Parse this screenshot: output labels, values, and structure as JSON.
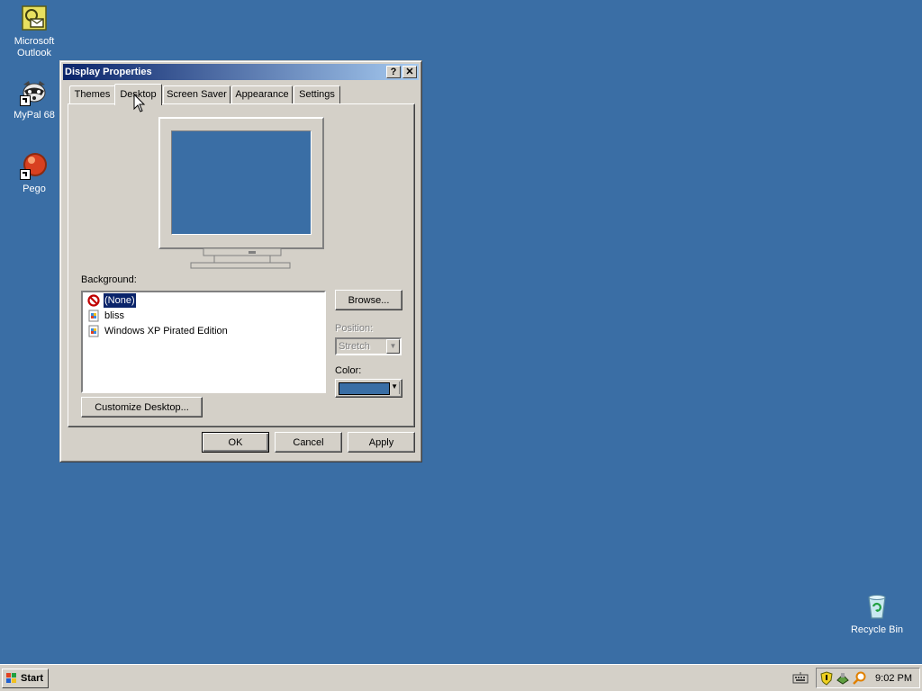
{
  "desktop": {
    "icons": [
      {
        "label": "Microsoft Outlook",
        "icon": "outlook-icon"
      },
      {
        "label": "MyPal 68",
        "icon": "raccoon-icon"
      },
      {
        "label": "Pego",
        "icon": "red-ball-icon"
      },
      {
        "label": "Recycle Bin",
        "icon": "recycle-bin-icon"
      }
    ],
    "background_color": "#3a6ea5"
  },
  "window": {
    "title": "Display Properties",
    "help_label": "?",
    "close_label": "✕",
    "tabs": [
      {
        "label": "Themes"
      },
      {
        "label": "Desktop",
        "active": true
      },
      {
        "label": "Screen Saver"
      },
      {
        "label": "Appearance"
      },
      {
        "label": "Settings"
      }
    ],
    "background_label": "Background:",
    "backgrounds": [
      {
        "label": "(None)",
        "icon": "no-symbol-icon",
        "selected": true
      },
      {
        "label": "bliss",
        "icon": "image-file-icon"
      },
      {
        "label": "Windows XP Pirated Edition",
        "icon": "image-file-icon"
      }
    ],
    "browse_label": "Browse...",
    "position_label": "Position:",
    "position_value": "Stretch",
    "color_label": "Color:",
    "color_value": "#3a6ea5",
    "customize_label": "Customize Desktop...",
    "ok_label": "OK",
    "cancel_label": "Cancel",
    "apply_label": "Apply"
  },
  "taskbar": {
    "start_label": "Start",
    "clock": "9:02 PM"
  }
}
